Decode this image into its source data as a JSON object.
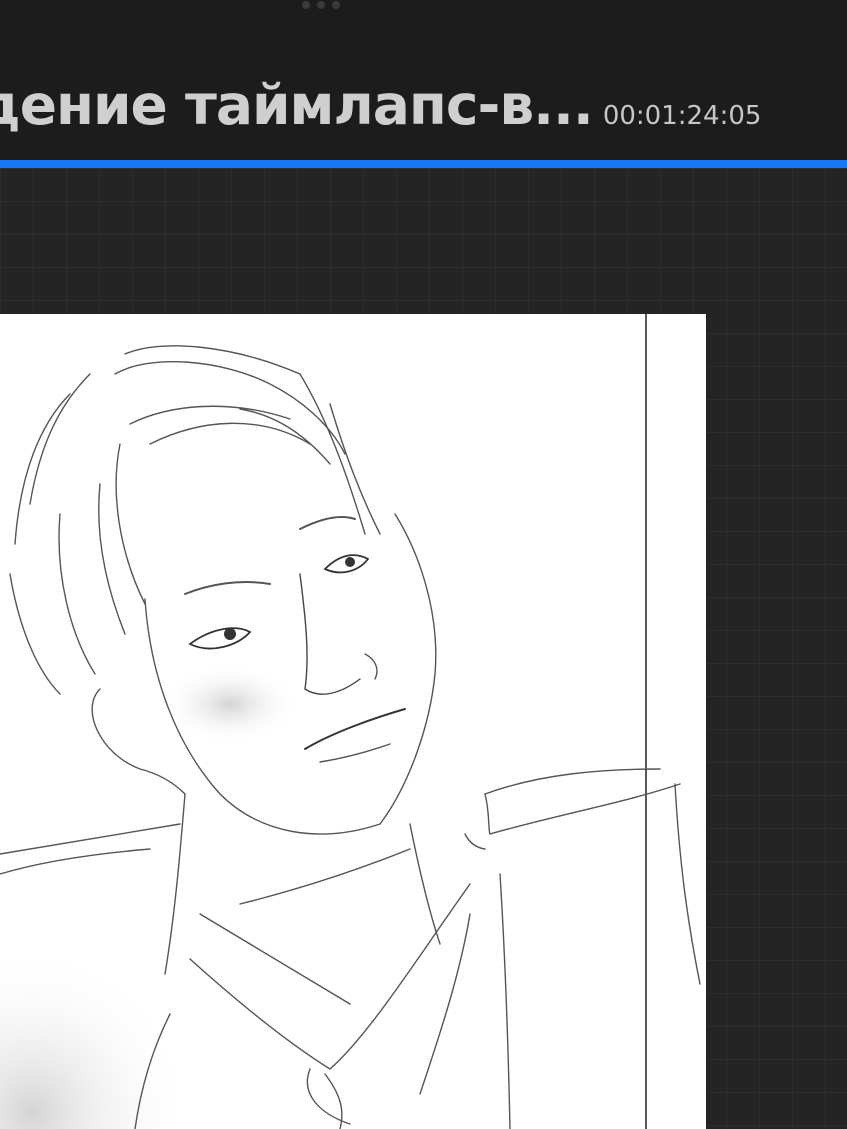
{
  "playback": {
    "title": "едение таймлапс-в...",
    "timecode": "00:01:24:05",
    "progress": 1.0
  },
  "colors": {
    "accent": "#1877f2",
    "background": "#1c1c1c",
    "canvas": "#ffffff"
  },
  "icons": {
    "grabber": "drag-handle-dots-icon"
  }
}
